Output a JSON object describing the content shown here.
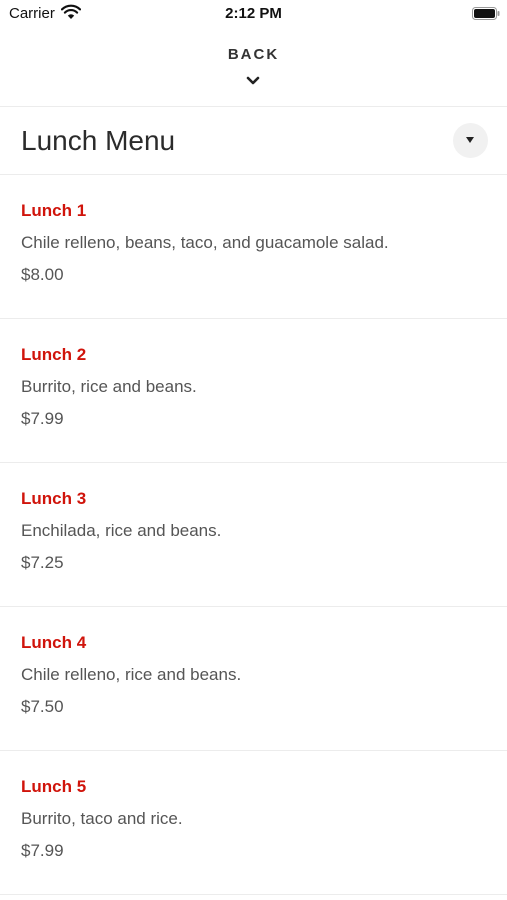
{
  "status_bar": {
    "carrier": "Carrier",
    "time": "2:12 PM",
    "wifi_icon": "wifi-icon",
    "battery_icon": "battery-icon"
  },
  "nav": {
    "back_label": "BACK",
    "back_icon": "chevron-down-icon"
  },
  "header": {
    "title": "Lunch Menu",
    "toggle_icon": "caret-down-icon"
  },
  "colors": {
    "item_name": "#d0140b",
    "text": "#555555",
    "divider": "#ececec"
  },
  "menu": {
    "items": [
      {
        "name": "Lunch 1",
        "description": "Chile relleno, beans, taco, and guacamole salad.",
        "price": "$8.00"
      },
      {
        "name": "Lunch 2",
        "description": "Burrito, rice and beans.",
        "price": "$7.99"
      },
      {
        "name": "Lunch 3",
        "description": "Enchilada, rice and beans.",
        "price": "$7.25"
      },
      {
        "name": "Lunch 4",
        "description": "Chile relleno, rice and beans.",
        "price": "$7.50"
      },
      {
        "name": "Lunch 5",
        "description": "Burrito, taco and rice.",
        "price": "$7.99"
      }
    ]
  }
}
